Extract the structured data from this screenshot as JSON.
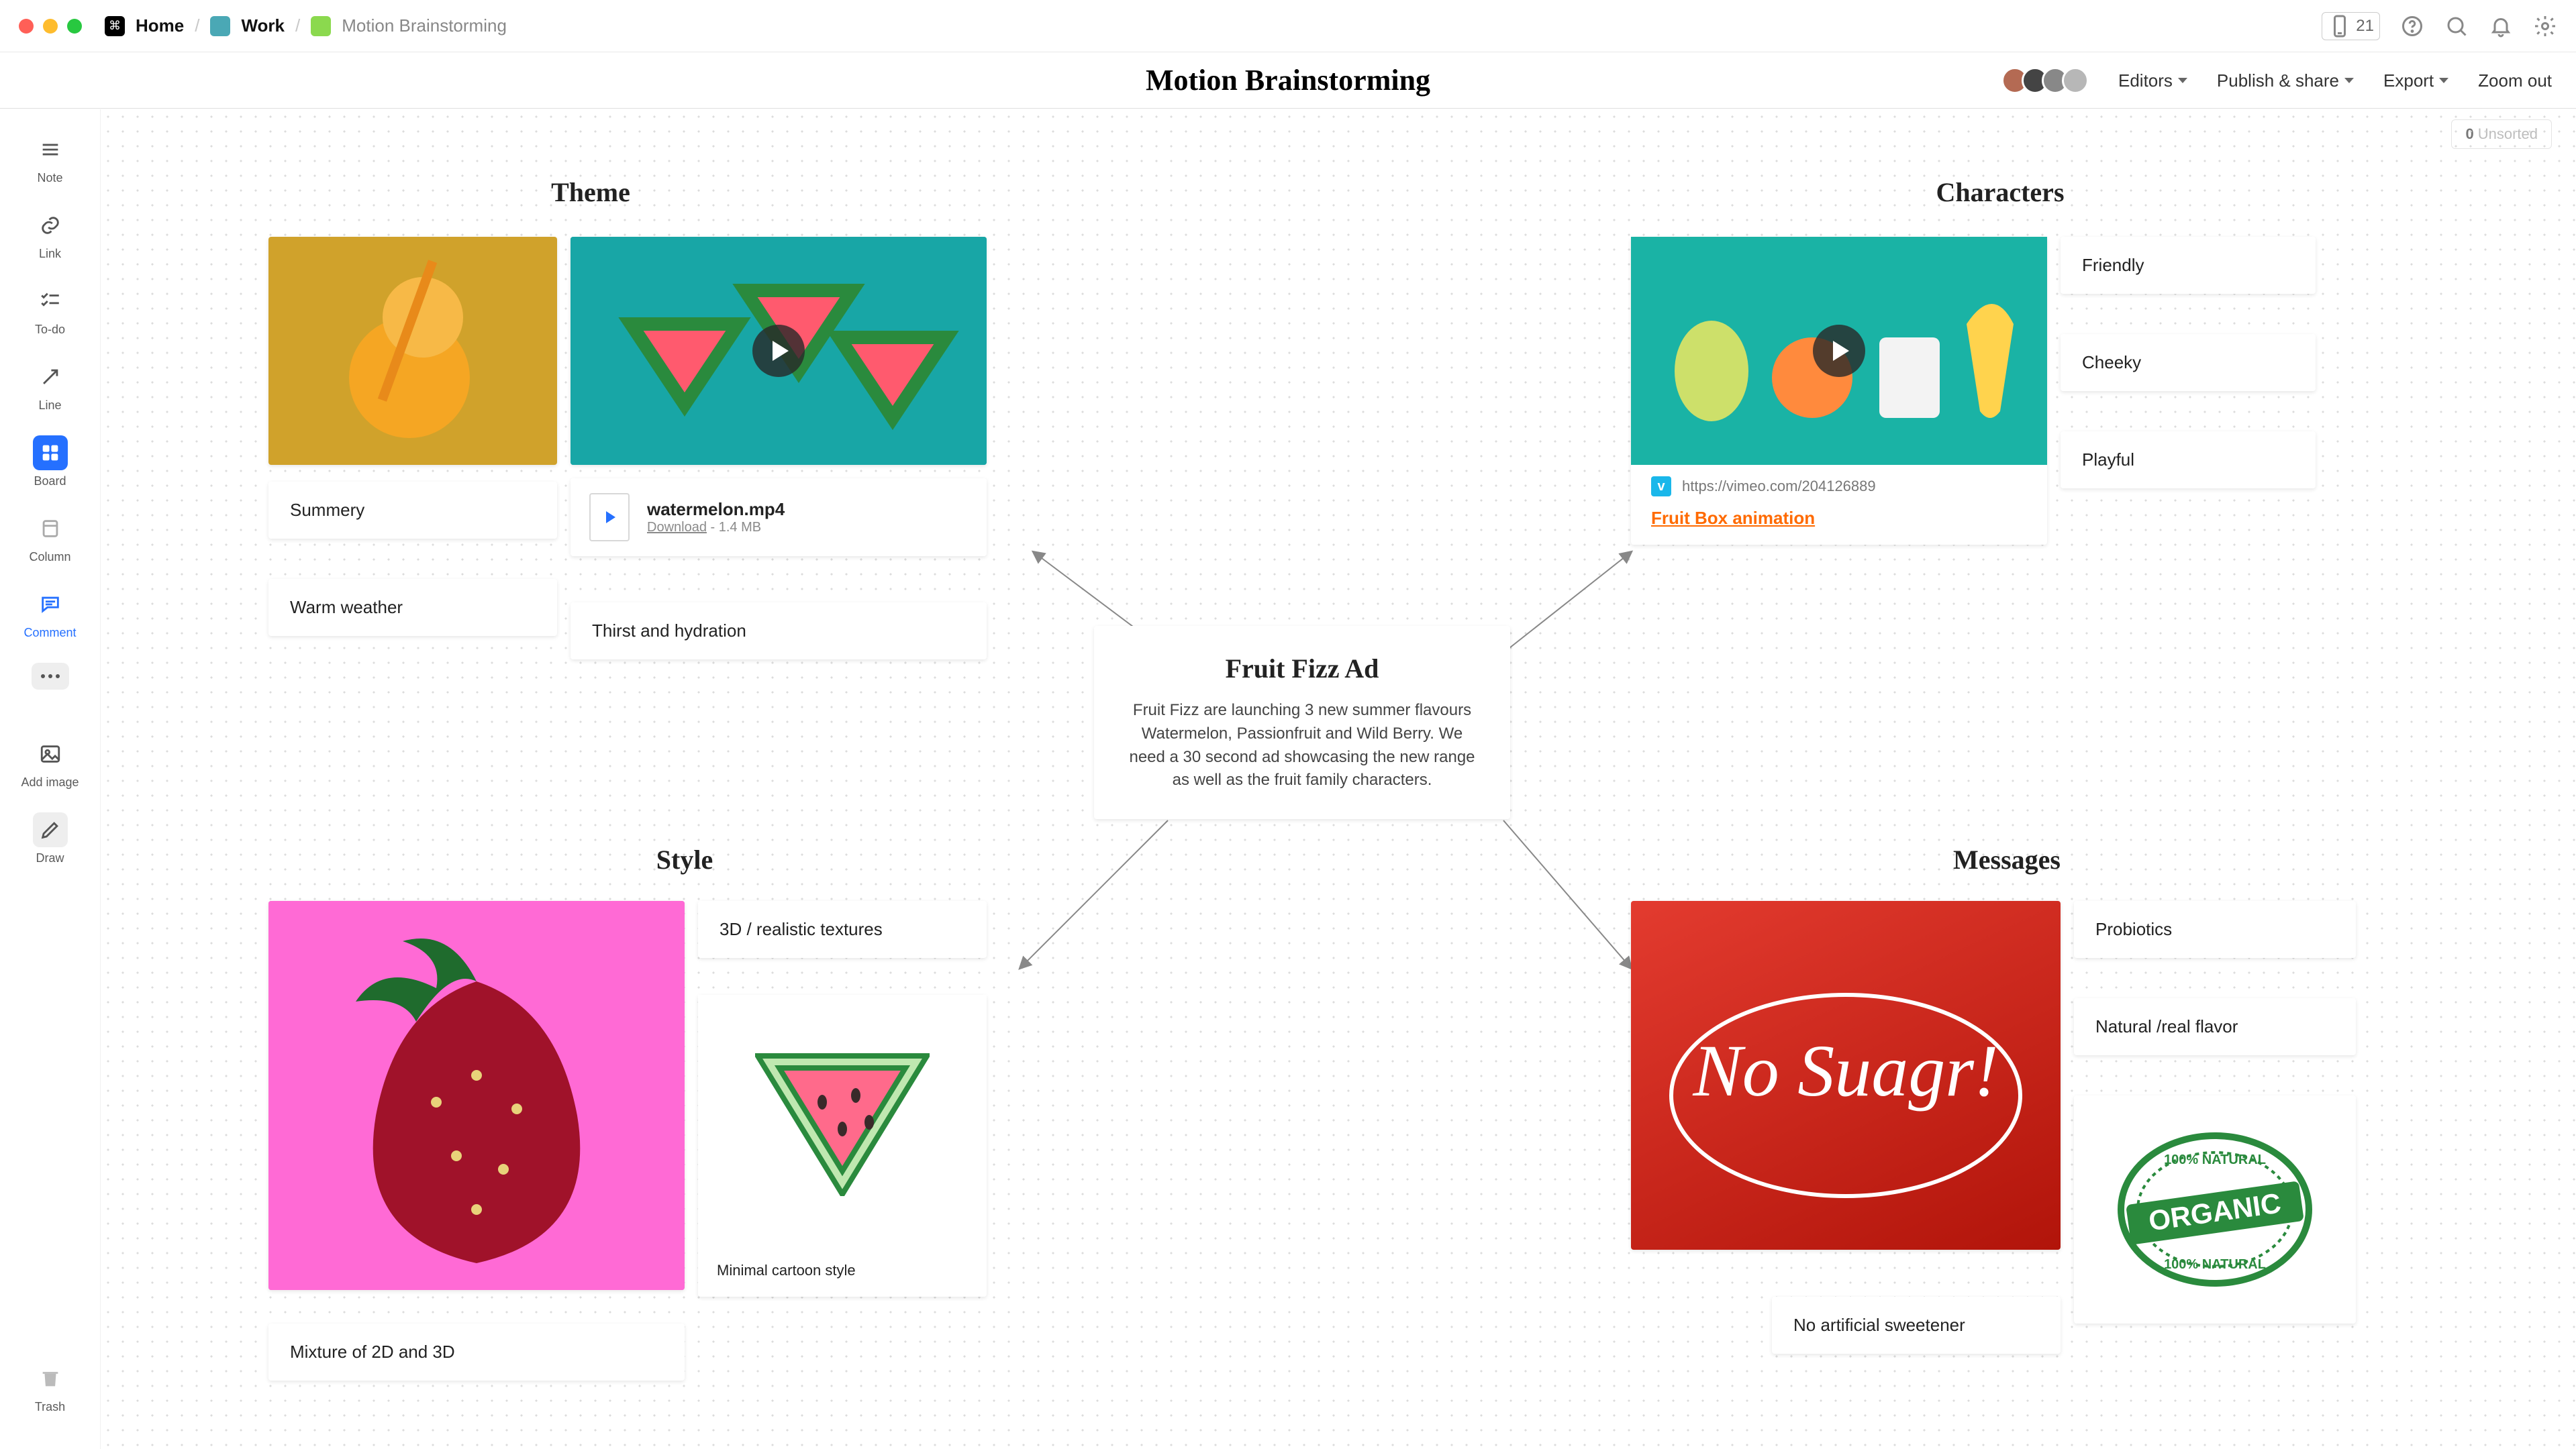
{
  "breadcrumb": {
    "home": "Home",
    "work": "Work",
    "current": "Motion Brainstorming"
  },
  "title": "Motion Brainstorming",
  "mobile_count": "21",
  "toolbar_right": {
    "editors": "Editors",
    "publish": "Publish & share",
    "export": "Export",
    "zoom": "Zoom out"
  },
  "unsorted": {
    "count": "0",
    "label": "Unsorted"
  },
  "sidebar": {
    "note": "Note",
    "link": "Link",
    "todo": "To-do",
    "line": "Line",
    "board": "Board",
    "column": "Column",
    "comment": "Comment",
    "addimage": "Add image",
    "draw": "Draw",
    "trash": "Trash"
  },
  "center_note": {
    "title": "Fruit Fizz Ad",
    "body": "Fruit Fizz are launching 3 new summer flavours Watermelon, Passionfruit and Wild Berry. We need a 30 second ad showcasing the new range as well as the fruit family characters."
  },
  "groups": {
    "theme": {
      "title": "Theme",
      "cards": {
        "summery": "Summery",
        "warm": "Warm weather",
        "thirst": "Thirst and hydration"
      },
      "file": {
        "name": "watermelon.mp4",
        "download": "Download",
        "size": "- 1.4 MB"
      }
    },
    "characters": {
      "title": "Characters",
      "link_url": "https://vimeo.com/204126889",
      "link_title": "Fruit Box animation",
      "cards": {
        "friendly": "Friendly",
        "cheeky": "Cheeky",
        "playful": "Playful"
      }
    },
    "style": {
      "title": "Style",
      "cards": {
        "textures": "3D / realistic textures",
        "mix": "Mixture of 2D and 3D",
        "cartoon": "Minimal cartoon style"
      }
    },
    "messages": {
      "title": "Messages",
      "image_text": "No Suagr!",
      "stamp": "ORGANIC",
      "cards": {
        "probiotics": "Probiotics",
        "natural": "Natural /real flavor",
        "noart": "No artificial sweetener"
      }
    }
  }
}
